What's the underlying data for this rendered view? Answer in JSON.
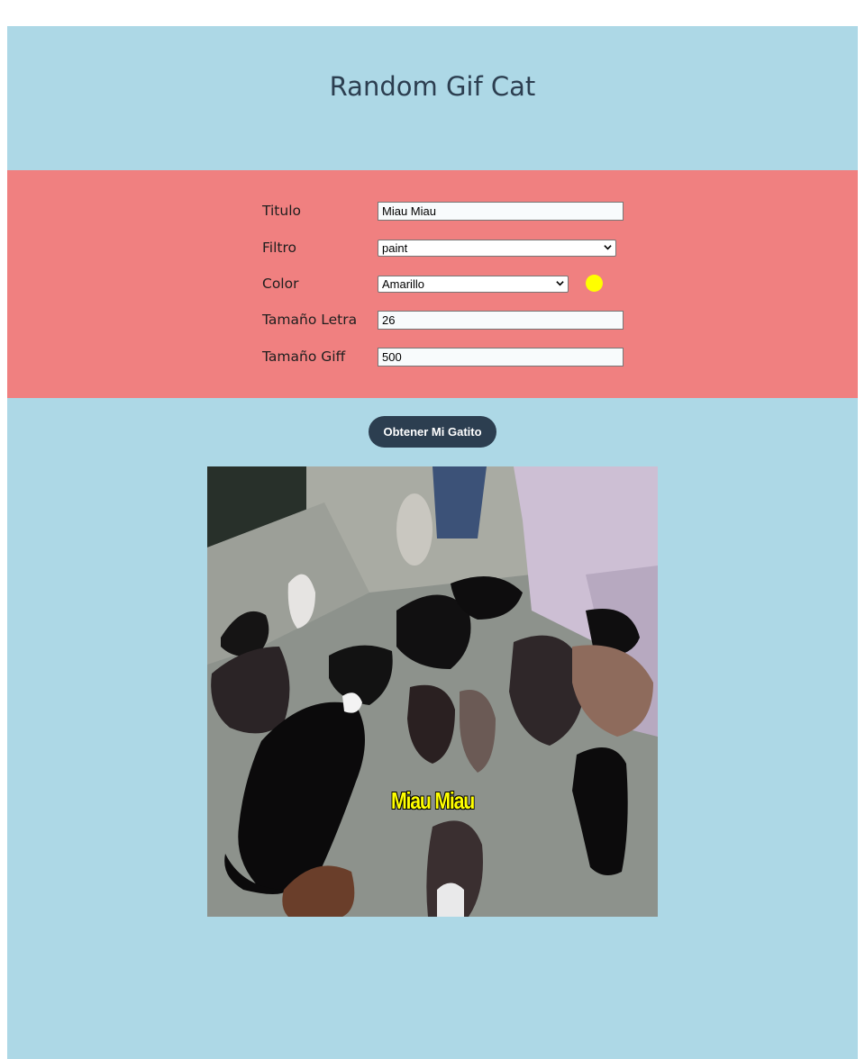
{
  "header": {
    "title": "Random Gif Cat"
  },
  "form": {
    "titulo": {
      "label": "Titulo",
      "value": "Miau Miau"
    },
    "filtro": {
      "label": "Filtro",
      "value": "paint"
    },
    "color": {
      "label": "Color",
      "value": "Amarillo",
      "swatch": "#ffff00"
    },
    "tamano_letra": {
      "label": "Tamaño Letra",
      "value": "26"
    },
    "tamano_giff": {
      "label": "Tamaño Giff",
      "value": "500"
    }
  },
  "button": {
    "label": "Obtener Mi Gatito"
  },
  "gif": {
    "caption": "Miau Miau",
    "caption_color": "#ffff00"
  },
  "colors": {
    "page_bg": "#add8e6",
    "form_bg": "#f08080",
    "title_color": "#2c3e50",
    "button_bg": "#2c3e50"
  }
}
